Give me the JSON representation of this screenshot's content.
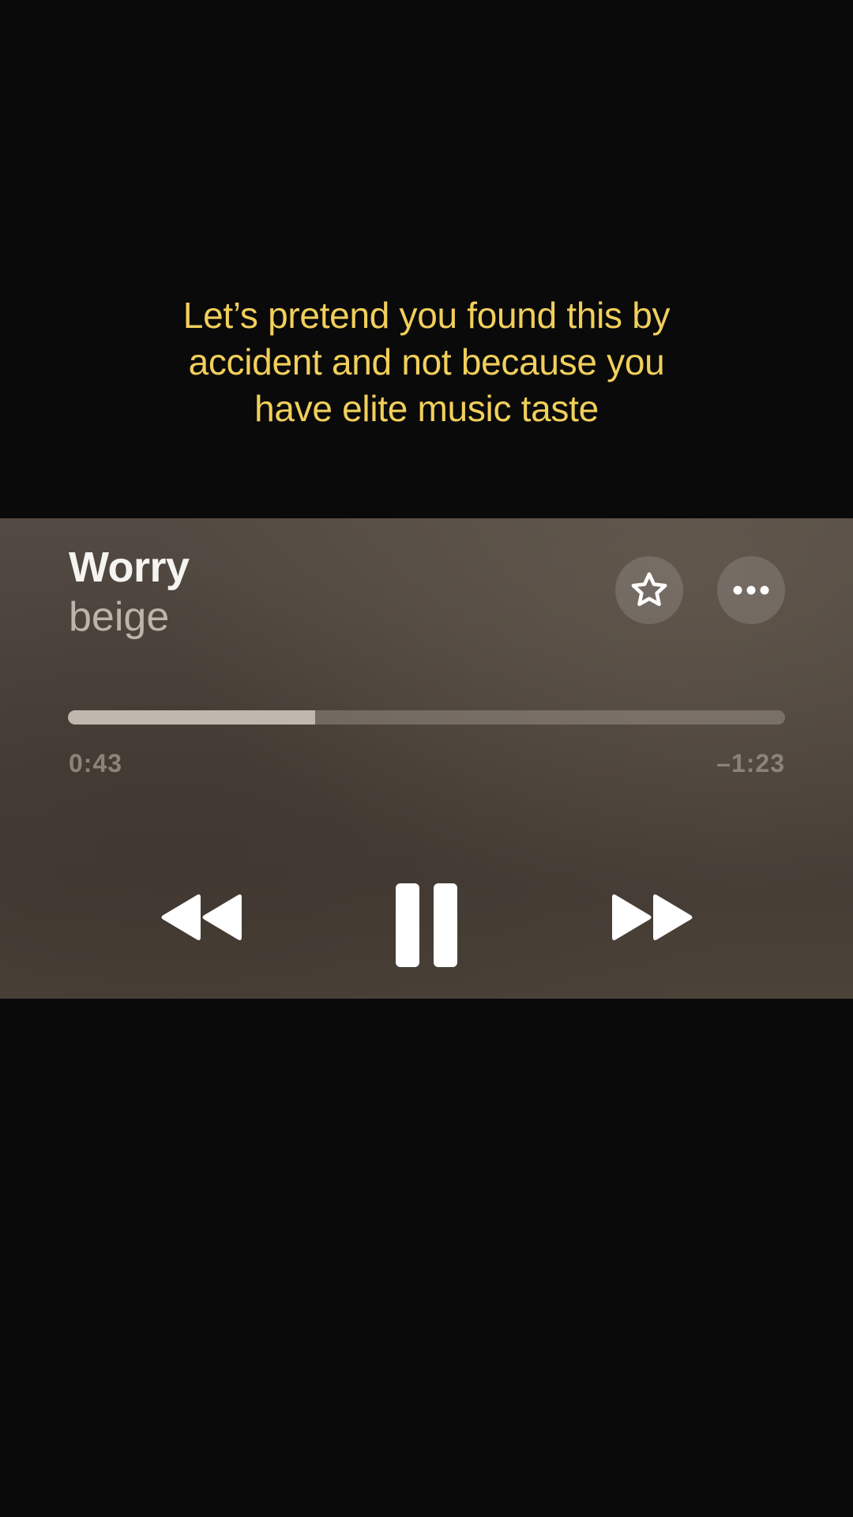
{
  "caption": {
    "line1": "Let’s pretend you found this by",
    "line2": "accident and not because you",
    "line3": "have elite music taste"
  },
  "player": {
    "title": "Worry",
    "artist": "beige",
    "elapsed": "0:43",
    "remaining": "–1:23",
    "progress_fraction": 0.345,
    "icons": [
      "star-icon",
      "more-icon",
      "rewind-icon",
      "pause-icon",
      "fast-forward-icon"
    ]
  },
  "colors": {
    "caption": "#f1cf5b",
    "background": "#0a0a0a",
    "player_background": "#4c443c",
    "progress_fill": "#c0b7ae"
  }
}
